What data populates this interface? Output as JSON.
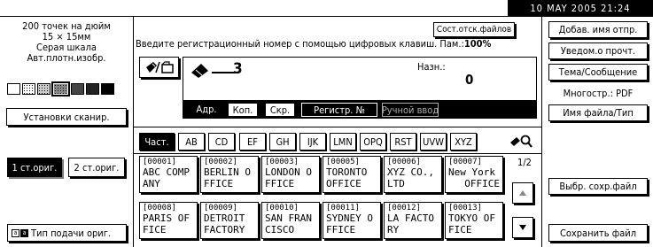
{
  "status": {
    "date_time": "10  MAY   2005 21:24"
  },
  "scan": {
    "resolution": "200 точек на дюйм",
    "size": "15 × 15мм",
    "gray": "Серая шкала",
    "density": "Авт.плотн.изобр.",
    "settings_button": "Установки сканир."
  },
  "original": {
    "one_side": "1 ст.ориг.",
    "two_side": "2 ст.ориг.",
    "feed_type": "Тип подачи ориг."
  },
  "message": "Введите регистрационный номер с помощью цифровых клавиш. Пам.:",
  "memory": "100%",
  "status_button": "Сост.отск.файлов",
  "dest_count": "3",
  "dest_label": "Назн.:",
  "dest_value": "0",
  "tabs": {
    "adr": "Адр.",
    "cop": "Коп.",
    "hid": "Скр.",
    "reg": "Регистр. №",
    "manual": "Ручной ввод"
  },
  "alpha_tabs": [
    "Част.",
    "AB",
    "CD",
    "EF",
    "GH",
    "IJK",
    "LMN",
    "OPQ",
    "RST",
    "UVW",
    "XYZ"
  ],
  "page_indicator": "1/2",
  "dest_entries": [
    {
      "num": "[00001]",
      "line1": "ABC COMP",
      "line2": "ANY"
    },
    {
      "num": "[00002]",
      "line1": "BERLIN O",
      "line2": "FFICE"
    },
    {
      "num": "[00003]",
      "line1": "LONDON O",
      "line2": "FFICE"
    },
    {
      "num": "[00005]",
      "line1": "TORONTO",
      "line2": "OFFICE"
    },
    {
      "num": "[00006]",
      "line1": "XYZ CO.,",
      "line2": "LTD"
    },
    {
      "num": "[00007]",
      "line1": "New York",
      "line2": "OFFICE"
    },
    {
      "num": "[00008]",
      "line1": "PARIS OF",
      "line2": "FICE"
    },
    {
      "num": "[00009]",
      "line1": "DETROIT",
      "line2": "FACTORY"
    },
    {
      "num": "[00010]",
      "line1": "SAN FRAN",
      "line2": "CISCO"
    },
    {
      "num": "[00011]",
      "line1": "SYDNEY O",
      "line2": "FFICE"
    },
    {
      "num": "[00012]",
      "line1": "LA FACTO",
      "line2": "RY"
    },
    {
      "num": "[00013]",
      "line1": "TOKYO OF",
      "line2": "FICE"
    }
  ],
  "right_panel": {
    "add_sender": "Добав. имя отпр.",
    "read_notice": "Уведом.о прочт.",
    "subject": "Тема/Сообщение",
    "multipage": "Многостр.: PDF",
    "file_name": "Имя файла/Тип",
    "select_stored": "Выбр. сохр.файл",
    "save_file": "Сохранить файл"
  }
}
